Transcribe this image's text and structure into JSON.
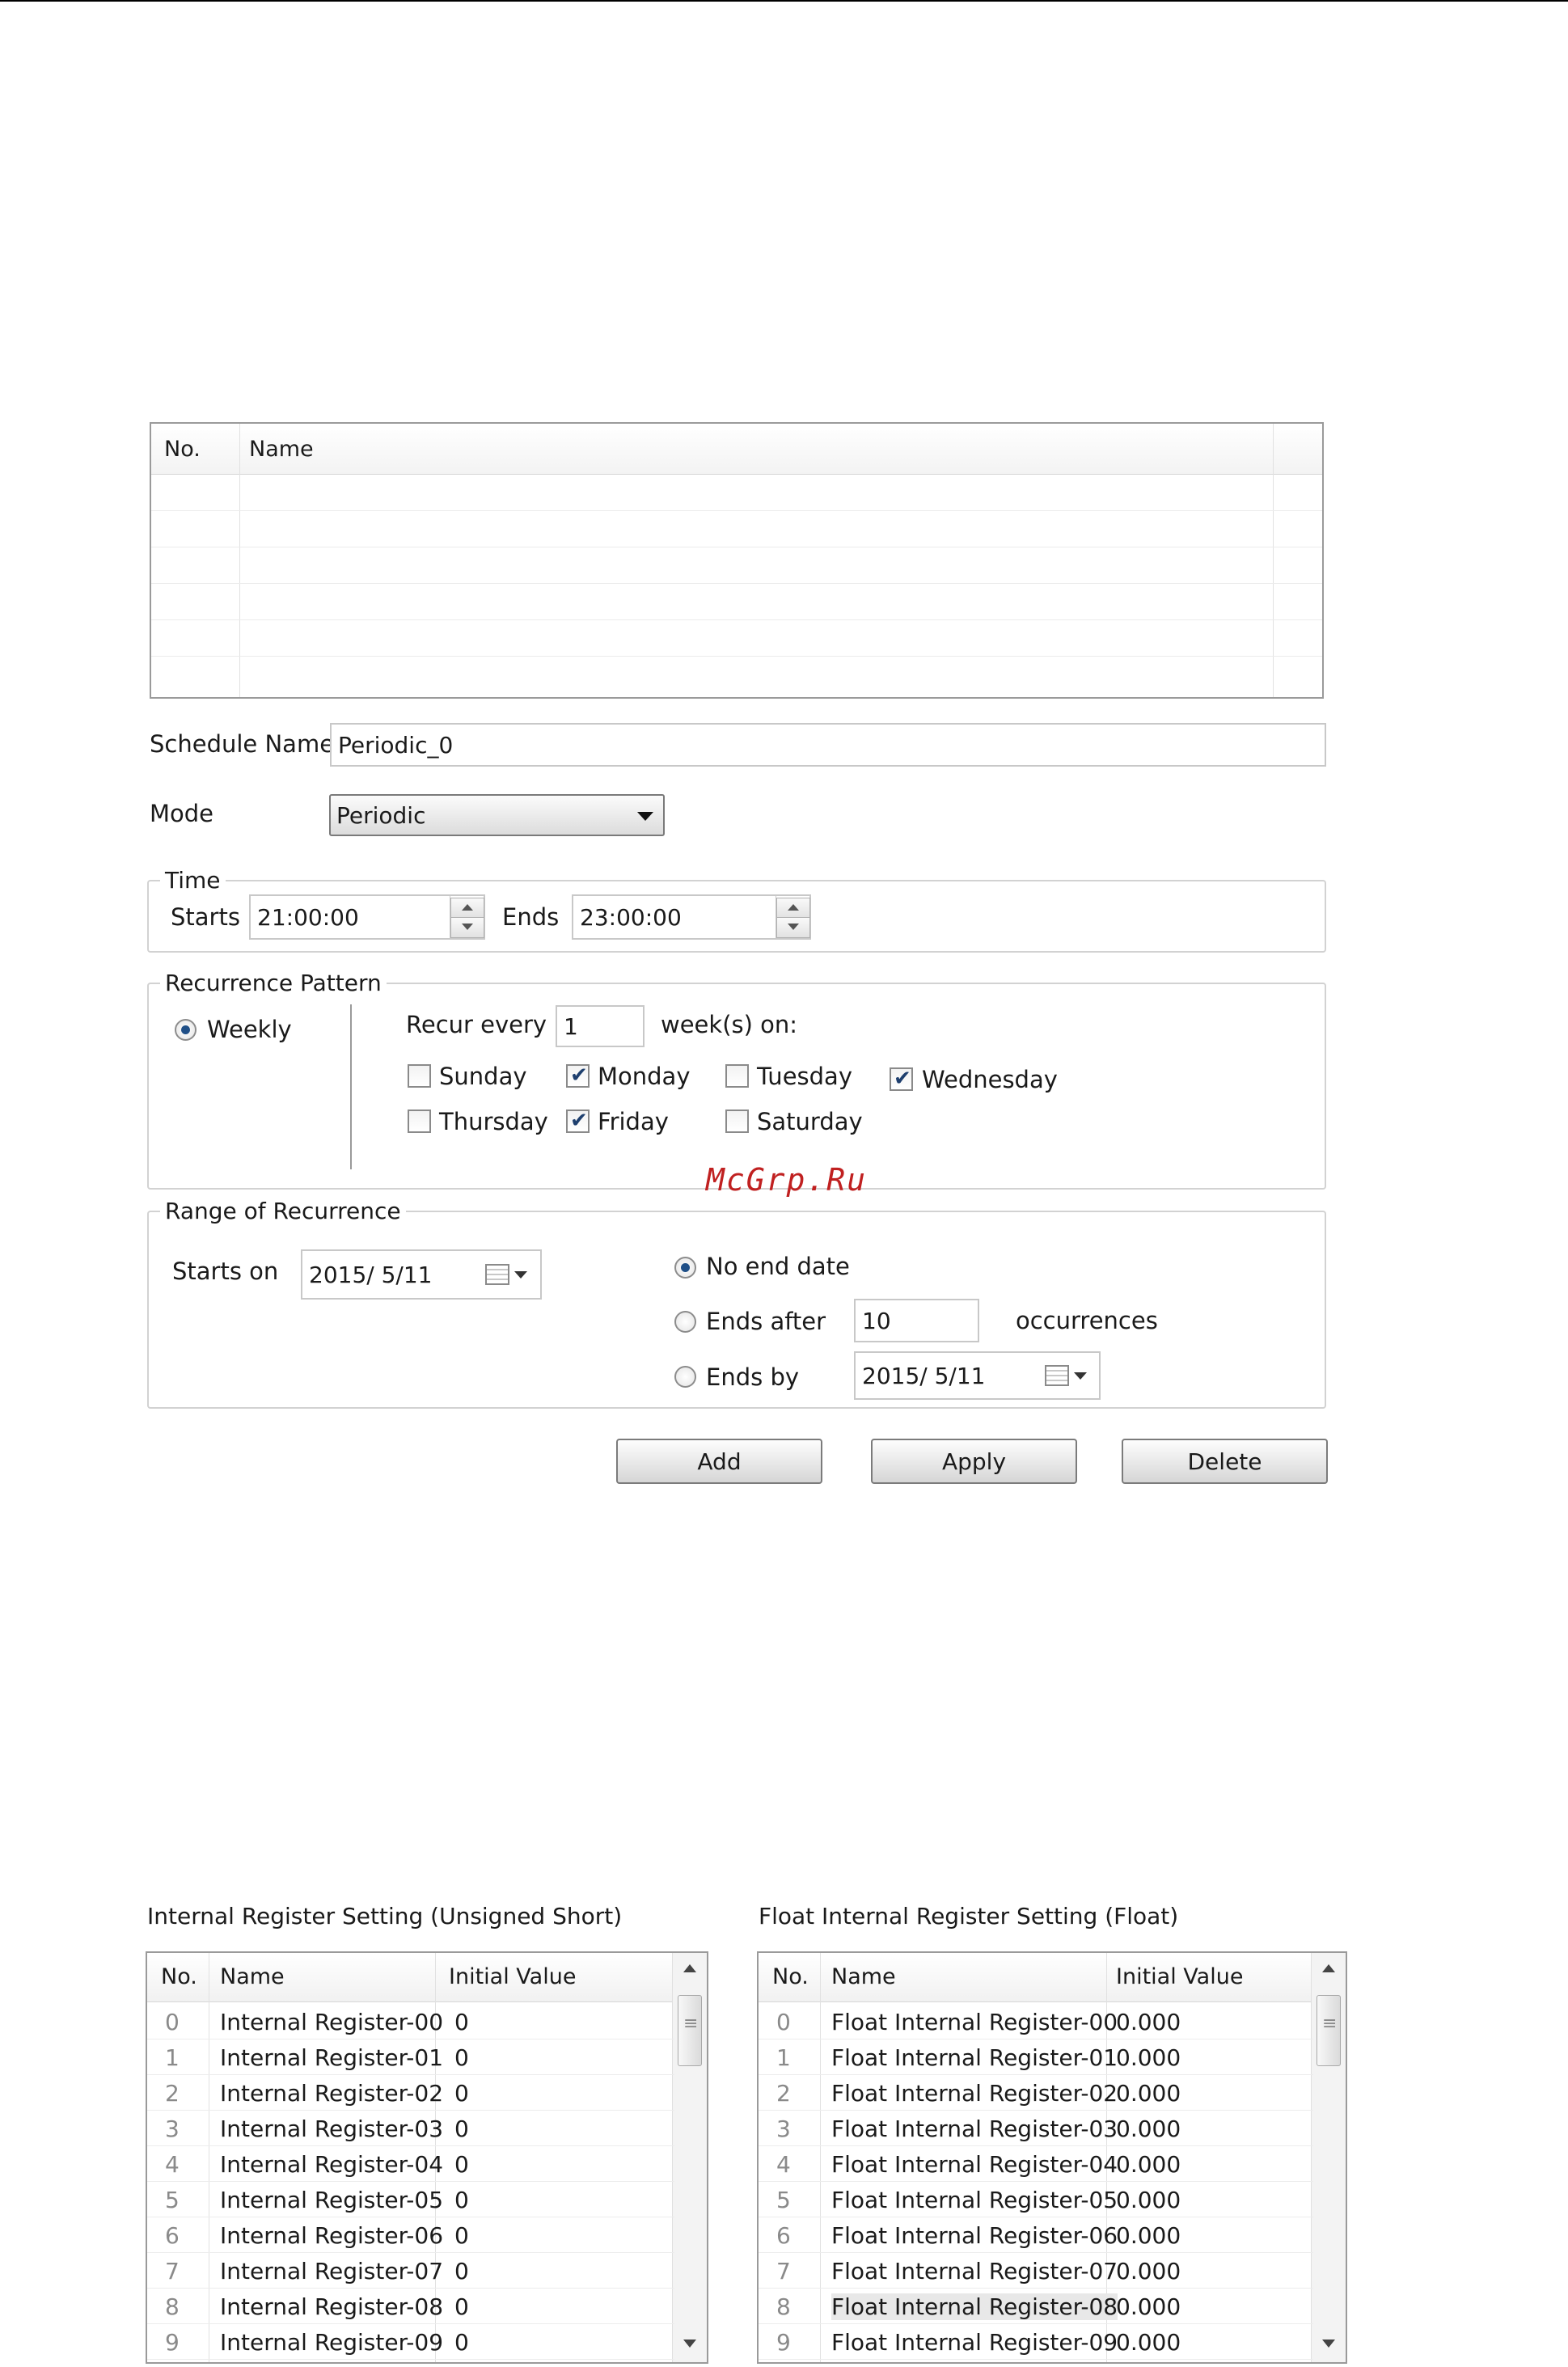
{
  "schedule": {
    "columns": [
      "No.",
      "Name"
    ],
    "name_label": "Schedule Name",
    "name_value": "Periodic_0",
    "mode_label": "Mode",
    "mode_value": "Periodic",
    "time": {
      "legend": "Time",
      "starts_label": "Starts",
      "starts_value": "21:00:00",
      "ends_label": "Ends",
      "ends_value": "23:00:00"
    },
    "recurrence": {
      "legend": "Recurrence Pattern",
      "weekly_label": "Weekly",
      "weekly_selected": true,
      "recur_every_label": "Recur every",
      "recur_every_value": "1",
      "weeks_on_label": "week(s) on:",
      "days": [
        {
          "label": "Sunday",
          "checked": false
        },
        {
          "label": "Monday",
          "checked": true
        },
        {
          "label": "Tuesday",
          "checked": false
        },
        {
          "label": "Wednesday",
          "checked": true
        },
        {
          "label": "Thursday",
          "checked": false
        },
        {
          "label": "Friday",
          "checked": true
        },
        {
          "label": "Saturday",
          "checked": false
        }
      ]
    },
    "range": {
      "legend": "Range of Recurrence",
      "starts_on_label": "Starts on",
      "starts_on_value": "2015/  5/11",
      "no_end_label": "No end date",
      "ends_after_label": "Ends after",
      "ends_after_value": "10",
      "occurrences_label": "occurrences",
      "ends_by_label": "Ends by",
      "ends_by_value": "2015/  5/11",
      "selected": "No end date"
    },
    "buttons": {
      "add": "Add",
      "apply": "Apply",
      "delete": "Delete"
    }
  },
  "watermark": "McGrp.Ru",
  "registers": {
    "title": "Internal Register Setting (Unsigned Short)",
    "columns": [
      "No.",
      "Name",
      "Initial Value"
    ],
    "rows": [
      {
        "no": "0",
        "name": "Internal Register-00",
        "value": "0"
      },
      {
        "no": "1",
        "name": "Internal Register-01",
        "value": "0"
      },
      {
        "no": "2",
        "name": "Internal Register-02",
        "value": "0"
      },
      {
        "no": "3",
        "name": "Internal Register-03",
        "value": "0"
      },
      {
        "no": "4",
        "name": "Internal Register-04",
        "value": "0"
      },
      {
        "no": "5",
        "name": "Internal Register-05",
        "value": "0"
      },
      {
        "no": "6",
        "name": "Internal Register-06",
        "value": "0"
      },
      {
        "no": "7",
        "name": "Internal Register-07",
        "value": "0"
      },
      {
        "no": "8",
        "name": "Internal Register-08",
        "value": "0"
      },
      {
        "no": "9",
        "name": "Internal Register-09",
        "value": "0"
      }
    ]
  },
  "float_registers": {
    "title": "Float Internal Register Setting (Float)",
    "columns": [
      "No.",
      "Name",
      "Initial Value"
    ],
    "highlighted_row": "8",
    "rows": [
      {
        "no": "0",
        "name": "Float Internal Register-00",
        "value": "0.000"
      },
      {
        "no": "1",
        "name": "Float Internal Register-01",
        "value": "0.000"
      },
      {
        "no": "2",
        "name": "Float Internal Register-02",
        "value": "0.000"
      },
      {
        "no": "3",
        "name": "Float Internal Register-03",
        "value": "0.000"
      },
      {
        "no": "4",
        "name": "Float Internal Register-04",
        "value": "0.000"
      },
      {
        "no": "5",
        "name": "Float Internal Register-05",
        "value": "0.000"
      },
      {
        "no": "6",
        "name": "Float Internal Register-06",
        "value": "0.000"
      },
      {
        "no": "7",
        "name": "Float Internal Register-07",
        "value": "0.000"
      },
      {
        "no": "8",
        "name": "Float Internal Register-08",
        "value": "0.000"
      },
      {
        "no": "9",
        "name": "Float Internal Register-09",
        "value": "0.000"
      }
    ]
  }
}
